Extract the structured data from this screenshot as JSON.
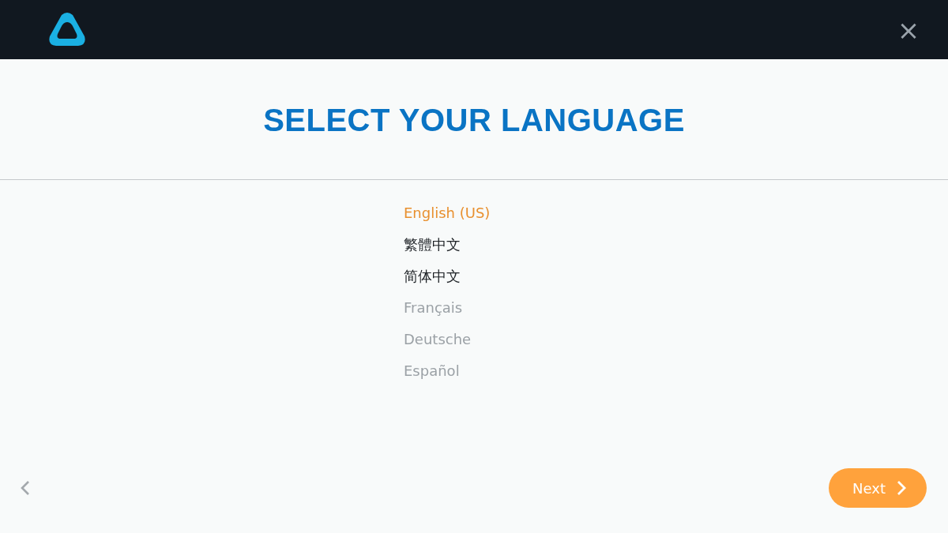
{
  "header": {
    "close_label": "×"
  },
  "title": "SELECT YOUR LANGUAGE",
  "languages": [
    {
      "label": "English (US)",
      "selected": true,
      "disabled": false
    },
    {
      "label": "繁體中文",
      "selected": false,
      "disabled": false
    },
    {
      "label": "简体中文",
      "selected": false,
      "disabled": false
    },
    {
      "label": "Français",
      "selected": false,
      "disabled": true
    },
    {
      "label": "Deutsche",
      "selected": false,
      "disabled": true
    },
    {
      "label": "Español",
      "selected": false,
      "disabled": true
    }
  ],
  "footer": {
    "next_button": "Next"
  }
}
